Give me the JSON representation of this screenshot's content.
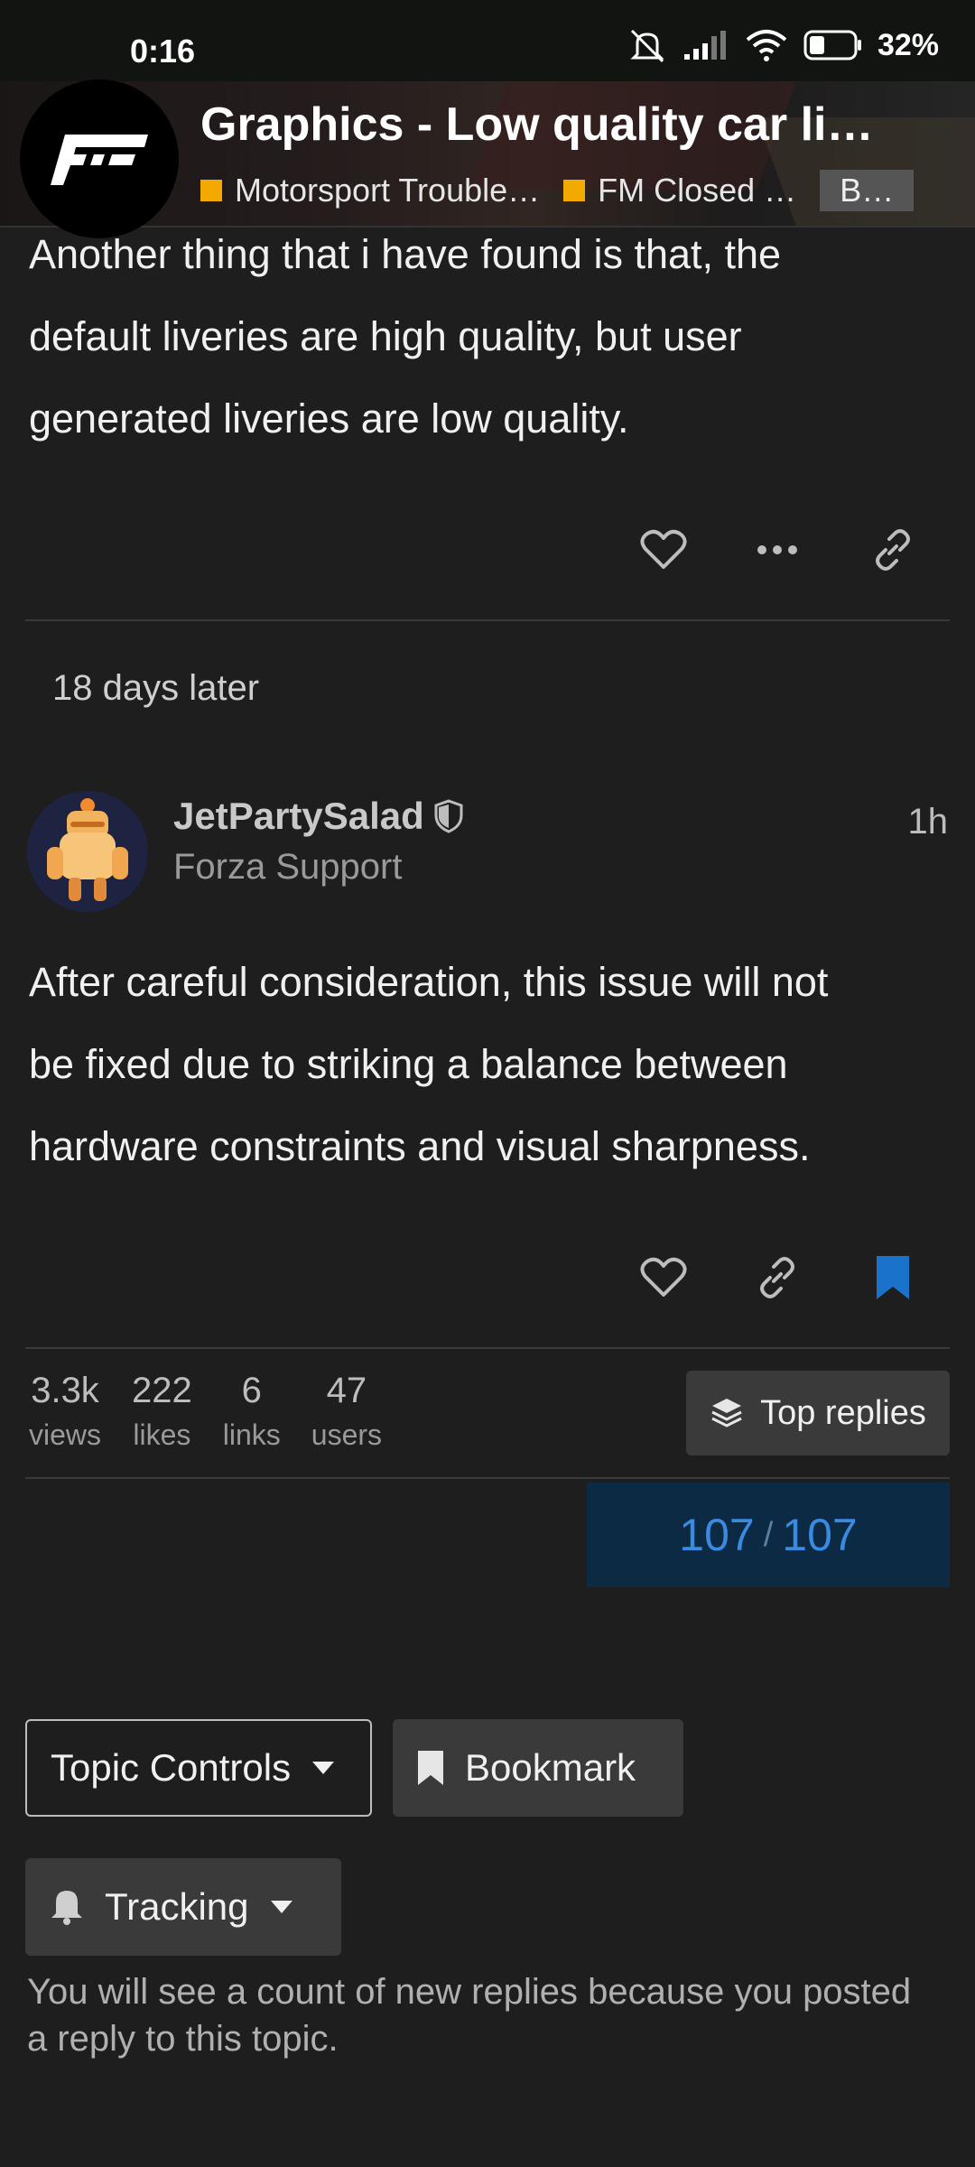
{
  "status": {
    "time": "0:16",
    "battery": "32%"
  },
  "header": {
    "title": "Graphics - Low quality car li…",
    "crumbs": [
      {
        "label": "Motorsport Trouble…",
        "color": "#f2a900"
      },
      {
        "label": "FM Closed …",
        "color": "#f2a900"
      }
    ],
    "tag": "B…"
  },
  "post1": {
    "lines": [
      "Another thing that i have found is that, the",
      "default liveries are high quality, but user",
      "generated liveries are low quality."
    ]
  },
  "gap": {
    "text": "18 days later"
  },
  "post2": {
    "username": "JetPartySalad",
    "user_title": "Forza Support",
    "time": "1h",
    "lines": [
      "After careful consideration, this issue will not",
      "be fixed due to striking a balance between",
      "hardware constraints and visual sharpness."
    ]
  },
  "stats": [
    {
      "num": "3.3k",
      "label": "views"
    },
    {
      "num": "222",
      "label": "likes"
    },
    {
      "num": "6",
      "label": "links"
    },
    {
      "num": "47",
      "label": "users"
    }
  ],
  "top_replies": {
    "label": "Top replies"
  },
  "progress": {
    "current": "107",
    "total": "107"
  },
  "controls": {
    "topic_controls": "Topic Controls",
    "bookmark": "Bookmark",
    "tracking": "Tracking",
    "tracking_desc": "You will see a count of new replies because you posted a reply to this topic."
  },
  "colors": {
    "accent": "#f2a900",
    "bookmark_active": "#1a73c8",
    "progress_text": "#3a8ae0"
  }
}
